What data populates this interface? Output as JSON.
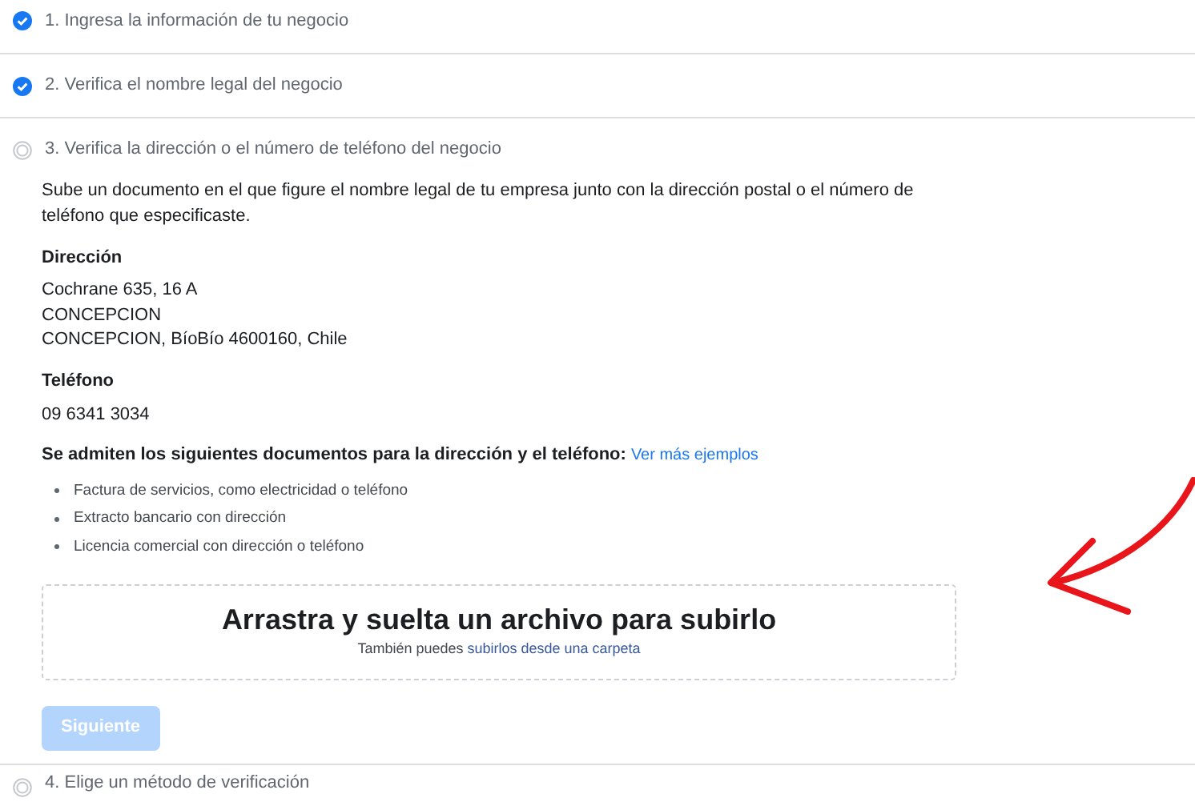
{
  "steps": [
    {
      "label": "1. Ingresa la información de tu negocio",
      "checked": true,
      "expanded": false
    },
    {
      "label": "2. Verifica el nombre legal del negocio",
      "checked": true,
      "expanded": false
    },
    {
      "label": "3. Verifica la dirección o el número de teléfono del negocio",
      "checked": false,
      "expanded": true
    },
    {
      "label": "4. Elige un método de verificación",
      "checked": false,
      "expanded": false
    }
  ],
  "details": {
    "intro": "Sube un documento en el que figure el nombre legal de tu empresa junto con la dirección postal o el número de teléfono que especificaste.",
    "address_heading": "Dirección",
    "address_lines": [
      "Cochrane 635, 16 A",
      "CONCEPCION",
      "CONCEPCION, BíoBío 4600160, Chile"
    ],
    "phone_heading": "Teléfono",
    "phone": "09 6341 3034",
    "documents_heading": "Se admiten los siguientes documentos para la dirección y el teléfono:",
    "documents_link": "Ver más ejemplos",
    "documents": [
      "Factura de servicios, como electricidad o teléfono",
      "Extracto bancario con dirección",
      "Licencia comercial con dirección o teléfono"
    ],
    "dropzone": {
      "title": "Arrastra y suelta un archivo para subirlo",
      "hint": "También puedes",
      "hint_link": "subirlos desde una carpeta"
    },
    "next_button": {
      "label": "Siguiente",
      "disabled": true
    }
  }
}
